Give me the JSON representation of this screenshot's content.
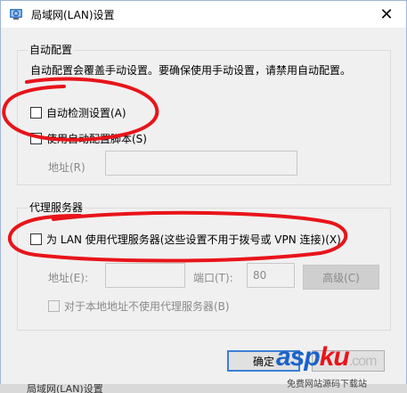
{
  "window": {
    "title": "局域网(LAN)设置",
    "close_glyph": "✕"
  },
  "auto_config": {
    "group_label": "自动配置",
    "description": "自动配置会覆盖手动设置。要确保使用手动设置，请禁用自动配置。",
    "auto_detect_label": "自动检测设置(A)",
    "auto_detect_checked": false,
    "use_script_label": "使用自动配置脚本(S)",
    "use_script_checked": false,
    "address_label": "地址(R)",
    "address_value": ""
  },
  "proxy": {
    "group_label": "代理服务器",
    "use_proxy_label": "为 LAN 使用代理服务器(这些设置不用于拨号或 VPN 连接)(X)",
    "use_proxy_checked": false,
    "address_label": "地址(E):",
    "address_value": "",
    "port_label": "端口(T):",
    "port_value": "80",
    "advanced_label": "高级(C)",
    "bypass_local_label": "对于本地地址不使用代理服务器(B)",
    "bypass_local_checked": false
  },
  "buttons": {
    "ok_label": "确定"
  },
  "background": {
    "window_title": "局域网(LAN)设置"
  },
  "watermark": {
    "brand": "aspku",
    "suffix": ".com",
    "tagline": "免费网站源码下载站"
  },
  "colors": {
    "annotation_red": "#e8141a",
    "accent_blue": "#3c7fd6",
    "watermark_blue": "#1a63c9",
    "watermark_red": "#e8141a"
  }
}
